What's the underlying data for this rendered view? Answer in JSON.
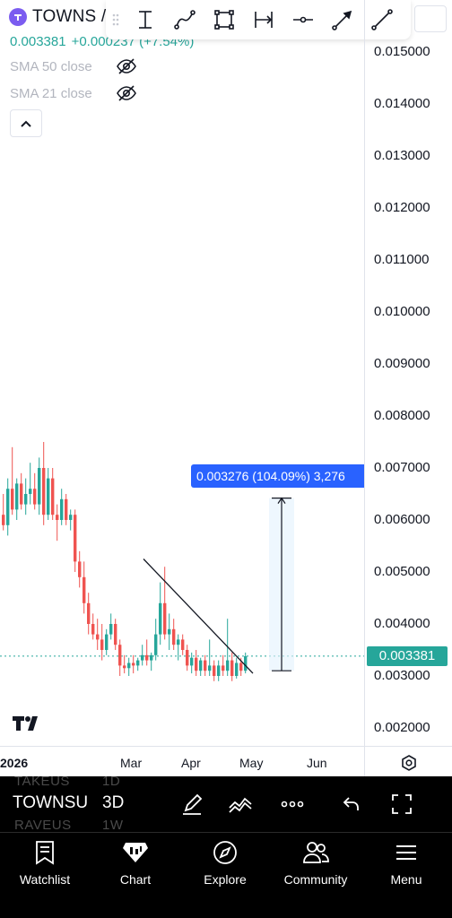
{
  "header": {
    "symbol": "TOWNS /",
    "logo_icon": "towns-logo-icon",
    "price_change": [
      "0.003381",
      "+0.000237 (+7.54%)"
    ],
    "change_color": "#26a69a"
  },
  "indicators": [
    {
      "label": "SMA 50 close",
      "visibility_icon": "eye-off-icon"
    },
    {
      "label": "SMA 21 close",
      "visibility_icon": "eye-off-icon"
    }
  ],
  "drawing_toolbar": {
    "tools": [
      "price-range-icon",
      "path-icon",
      "rectangle-icon",
      "date-range-icon",
      "horizontal-ray-icon",
      "arrow-icon",
      "trend-line-icon"
    ]
  },
  "price_axis": {
    "labels": [
      "0.015000",
      "0.014000",
      "0.013000",
      "0.012000",
      "0.011000",
      "0.010000",
      "0.009000",
      "0.008000",
      "0.007000",
      "0.006000",
      "0.005000",
      "0.004000",
      "0.003000",
      "0.002000"
    ],
    "last_price": "0.003381",
    "last_price_color": "#26a69a"
  },
  "time_axis": {
    "labels": [
      "2026",
      "Mar",
      "Apr",
      "May",
      "Jun"
    ]
  },
  "measure": {
    "label": "0.003276 (104.09%) 3,276",
    "color": "#2962ff"
  },
  "chart_data": {
    "type": "candlestick",
    "y_range": [
      0.0018,
      0.0156
    ],
    "x_labels": [
      "2026",
      "Mar",
      "Apr",
      "May",
      "Jun"
    ],
    "up_color": "#26a69a",
    "down_color": "#ef5350",
    "candles": [
      {
        "o": 0.0061,
        "h": 0.0065,
        "l": 0.0058,
        "c": 0.0059
      },
      {
        "o": 0.0059,
        "h": 0.0068,
        "l": 0.0057,
        "c": 0.0066
      },
      {
        "o": 0.0066,
        "h": 0.0074,
        "l": 0.0061,
        "c": 0.0062
      },
      {
        "o": 0.0062,
        "h": 0.0068,
        "l": 0.006,
        "c": 0.0067
      },
      {
        "o": 0.0067,
        "h": 0.0069,
        "l": 0.0062,
        "c": 0.0063
      },
      {
        "o": 0.0063,
        "h": 0.0068,
        "l": 0.0061,
        "c": 0.0065
      },
      {
        "o": 0.0065,
        "h": 0.0071,
        "l": 0.0063,
        "c": 0.0066
      },
      {
        "o": 0.0066,
        "h": 0.0069,
        "l": 0.0062,
        "c": 0.0063
      },
      {
        "o": 0.0063,
        "h": 0.0072,
        "l": 0.0061,
        "c": 0.007
      },
      {
        "o": 0.007,
        "h": 0.0075,
        "l": 0.0059,
        "c": 0.0061
      },
      {
        "o": 0.0061,
        "h": 0.007,
        "l": 0.006,
        "c": 0.0068
      },
      {
        "o": 0.0068,
        "h": 0.007,
        "l": 0.006,
        "c": 0.0061
      },
      {
        "o": 0.0061,
        "h": 0.0063,
        "l": 0.0056,
        "c": 0.006
      },
      {
        "o": 0.006,
        "h": 0.0066,
        "l": 0.0059,
        "c": 0.0064
      },
      {
        "o": 0.0064,
        "h": 0.0065,
        "l": 0.0059,
        "c": 0.006
      },
      {
        "o": 0.006,
        "h": 0.0062,
        "l": 0.0058,
        "c": 0.0061
      },
      {
        "o": 0.0061,
        "h": 0.0062,
        "l": 0.005,
        "c": 0.0052
      },
      {
        "o": 0.0052,
        "h": 0.0054,
        "l": 0.0047,
        "c": 0.0049
      },
      {
        "o": 0.0049,
        "h": 0.0052,
        "l": 0.0042,
        "c": 0.0044
      },
      {
        "o": 0.0044,
        "h": 0.0046,
        "l": 0.0038,
        "c": 0.004
      },
      {
        "o": 0.004,
        "h": 0.0042,
        "l": 0.0037,
        "c": 0.0038
      },
      {
        "o": 0.0038,
        "h": 0.0041,
        "l": 0.0035,
        "c": 0.0037
      },
      {
        "o": 0.0037,
        "h": 0.004,
        "l": 0.0033,
        "c": 0.0035
      },
      {
        "o": 0.0035,
        "h": 0.0039,
        "l": 0.0034,
        "c": 0.0038
      },
      {
        "o": 0.0038,
        "h": 0.0042,
        "l": 0.0037,
        "c": 0.004
      },
      {
        "o": 0.004,
        "h": 0.0041,
        "l": 0.0035,
        "c": 0.0036
      },
      {
        "o": 0.0036,
        "h": 0.0037,
        "l": 0.003,
        "c": 0.0032
      },
      {
        "o": 0.0032,
        "h": 0.0034,
        "l": 0.00305,
        "c": 0.00315
      },
      {
        "o": 0.00315,
        "h": 0.00335,
        "l": 0.003,
        "c": 0.00325
      },
      {
        "o": 0.00325,
        "h": 0.0034,
        "l": 0.00305,
        "c": 0.0032
      },
      {
        "o": 0.0032,
        "h": 0.00335,
        "l": 0.0031,
        "c": 0.0033
      },
      {
        "o": 0.0033,
        "h": 0.0036,
        "l": 0.0032,
        "c": 0.0034
      },
      {
        "o": 0.0034,
        "h": 0.0037,
        "l": 0.0032,
        "c": 0.0033
      },
      {
        "o": 0.0033,
        "h": 0.00345,
        "l": 0.0031,
        "c": 0.0034
      },
      {
        "o": 0.0034,
        "h": 0.0041,
        "l": 0.0033,
        "c": 0.0038
      },
      {
        "o": 0.0038,
        "h": 0.0048,
        "l": 0.0036,
        "c": 0.0044
      },
      {
        "o": 0.0044,
        "h": 0.0051,
        "l": 0.0037,
        "c": 0.0038
      },
      {
        "o": 0.0038,
        "h": 0.0042,
        "l": 0.0035,
        "c": 0.0039
      },
      {
        "o": 0.0039,
        "h": 0.0041,
        "l": 0.0035,
        "c": 0.0036
      },
      {
        "o": 0.0036,
        "h": 0.0038,
        "l": 0.0033,
        "c": 0.0037
      },
      {
        "o": 0.0037,
        "h": 0.0038,
        "l": 0.0034,
        "c": 0.0035
      },
      {
        "o": 0.0035,
        "h": 0.0036,
        "l": 0.0031,
        "c": 0.0032
      },
      {
        "o": 0.0032,
        "h": 0.00345,
        "l": 0.00305,
        "c": 0.00335
      },
      {
        "o": 0.00335,
        "h": 0.0035,
        "l": 0.003,
        "c": 0.0031
      },
      {
        "o": 0.0031,
        "h": 0.00335,
        "l": 0.003,
        "c": 0.0033
      },
      {
        "o": 0.0033,
        "h": 0.0034,
        "l": 0.003,
        "c": 0.0031
      },
      {
        "o": 0.0031,
        "h": 0.0037,
        "l": 0.003,
        "c": 0.0032
      },
      {
        "o": 0.0032,
        "h": 0.0033,
        "l": 0.0029,
        "c": 0.003
      },
      {
        "o": 0.003,
        "h": 0.0033,
        "l": 0.0029,
        "c": 0.0032
      },
      {
        "o": 0.0032,
        "h": 0.0034,
        "l": 0.003,
        "c": 0.0031
      },
      {
        "o": 0.0031,
        "h": 0.0041,
        "l": 0.003,
        "c": 0.0033
      },
      {
        "o": 0.0033,
        "h": 0.00345,
        "l": 0.0029,
        "c": 0.003
      },
      {
        "o": 0.003,
        "h": 0.00335,
        "l": 0.00295,
        "c": 0.00325
      },
      {
        "o": 0.00325,
        "h": 0.00335,
        "l": 0.003,
        "c": 0.0031
      },
      {
        "o": 0.0031,
        "h": 0.00345,
        "l": 0.00305,
        "c": 0.00338
      }
    ],
    "trend_line": {
      "from": 0.00525,
      "to": 0.00305
    },
    "measure_range": {
      "from": 0.0031,
      "to": 0.00642
    },
    "grid": false,
    "scale": "linear"
  },
  "symbol_bar": {
    "ghost_top": [
      "TAKEUS",
      "1D"
    ],
    "symbol": "TOWNSU",
    "timeframe": "3D",
    "ghost_bottom": [
      "RAVEUS",
      "1W"
    ],
    "icons": [
      "pen-icon",
      "indicators-icon",
      "more-icon",
      "undo-icon",
      "fullscreen-icon"
    ]
  },
  "nav": [
    {
      "label": "Watchlist",
      "icon": "watchlist-icon"
    },
    {
      "label": "Chart",
      "icon": "chart-icon"
    },
    {
      "label": "Explore",
      "icon": "compass-icon"
    },
    {
      "label": "Community",
      "icon": "community-icon"
    },
    {
      "label": "Menu",
      "icon": "menu-icon"
    }
  ]
}
